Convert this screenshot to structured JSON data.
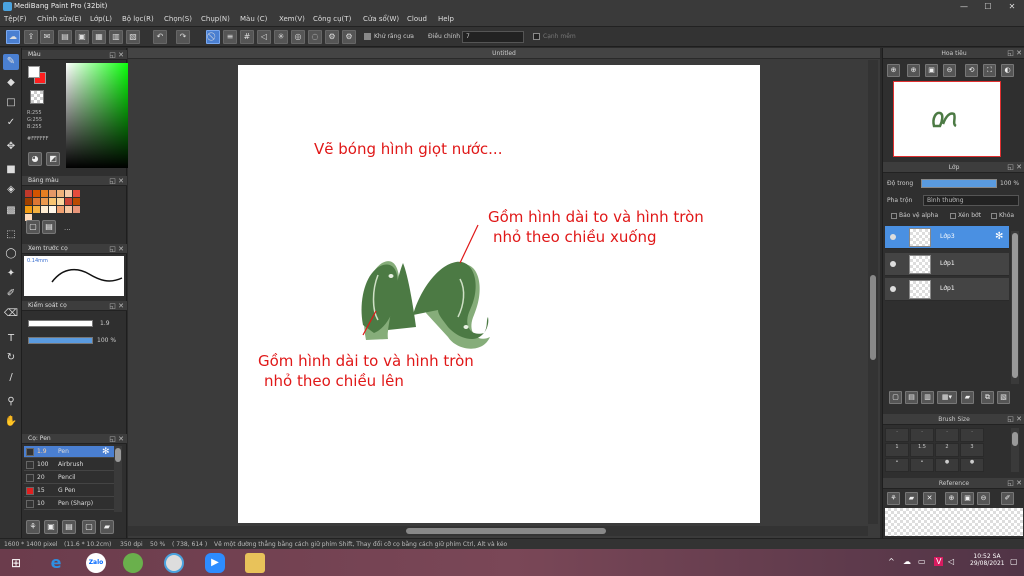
{
  "window": {
    "title": "MediBang Paint Pro (32bit)",
    "minimize": "—",
    "maximize": "☐",
    "close": "✕"
  },
  "menu": [
    "Tệp(F)",
    "Chỉnh sửa(E)",
    "Lớp(L)",
    "Bộ lọc(R)",
    "Chọn(S)",
    "Chụp(N)",
    "Màu (C)",
    "Xem(V)",
    "Công cụ(T)",
    "Cửa sổ(W)",
    "Cloud",
    "Help"
  ],
  "toolbar": {
    "antialias_label": "Khử răng cưa",
    "correction_label": "Điều chỉnh",
    "correction_value": "7",
    "snap_label": "Cạnh mềm"
  },
  "color_panel": {
    "title": "Màu",
    "r": "R:255",
    "g": "G:255",
    "b": "B:255",
    "hex": "#FFFFFF"
  },
  "palette_panel": {
    "title": "Bảng màu",
    "more": "...",
    "swatches": [
      "#c0392b",
      "#d35400",
      "#e67e22",
      "#e59866",
      "#f0b27a",
      "#f5cba7",
      "#e74c3c",
      "#a04000",
      "#dc7633",
      "#eb984e",
      "#f8c471",
      "#fad7a0",
      "#cb4335",
      "#ba4a00",
      "#f39c12",
      "#f5b041",
      "#fdebd0",
      "#fef5e7",
      "#f0a070",
      "#f7c6a0",
      "#e9967a",
      "#ffdab9"
    ]
  },
  "brush_preview": {
    "title": "Xem trước cọ",
    "size": "0.14mm"
  },
  "brush_control": {
    "title": "Kiểm soát cọ",
    "size": "1.9",
    "opacity": "100 %"
  },
  "brush_list": {
    "title": "Cọ: Pen",
    "items": [
      {
        "size": "1.9",
        "name": "Pen",
        "color": "#222222"
      },
      {
        "size": "100",
        "name": "Airbrush",
        "color": "#222222"
      },
      {
        "size": "20",
        "name": "Pencil",
        "color": "#222222"
      },
      {
        "size": "15",
        "name": "G Pen",
        "color": "#e02020"
      },
      {
        "size": "10",
        "name": "Pen (Sharp)",
        "color": "#222222"
      }
    ]
  },
  "canvas": {
    "tab": "Untitled",
    "annotation_top": "Vẽ bóng hình giọt nước...",
    "annotation_right_1": "Gồm hình dài to và hình tròn",
    "annotation_right_2": "nhỏ theo chiều xuống",
    "annotation_left_1": "Gồm hình dài to và hình tròn",
    "annotation_left_2": "nhỏ theo chiều lên",
    "stroke_color": "#4c7a44",
    "shadow_color": "#7fa572",
    "annotation_color": "#e01818"
  },
  "navigator": {
    "title": "Hoa tiêu"
  },
  "layer_panel": {
    "title": "Lớp",
    "opacity_label": "Độ trong",
    "opacity_value": "100 %",
    "blend_label": "Pha trộn",
    "blend_value": "Bình thường",
    "protect_alpha": "Bảo vệ alpha",
    "clipping": "Xén bớt",
    "lock": "Khóa",
    "layers": [
      {
        "name": "Lớp3",
        "active": true
      },
      {
        "name": "Lớp1",
        "active": false
      },
      {
        "name": "Lớp1",
        "active": false
      }
    ]
  },
  "brush_size_panel": {
    "title": "Brush Size",
    "values": [
      "1",
      "1.5",
      "2",
      "3"
    ]
  },
  "reference_panel": {
    "title": "Reference"
  },
  "status": {
    "dimensions": "1600 * 1400 pixel",
    "physical": "(11.6 * 10.2cm)",
    "dpi": "350 dpi",
    "zoom": "50 %",
    "cursor": "( 738, 614 )",
    "hint": "Vẽ một đường thẳng bằng cách giữ phím Shift, Thay đổi cỡ cọ bằng cách giữ phím Ctrl, Alt và kéo"
  },
  "taskbar": {
    "zalo": "Zalo",
    "time": "10:52 SA",
    "date": "29/08/2021"
  }
}
